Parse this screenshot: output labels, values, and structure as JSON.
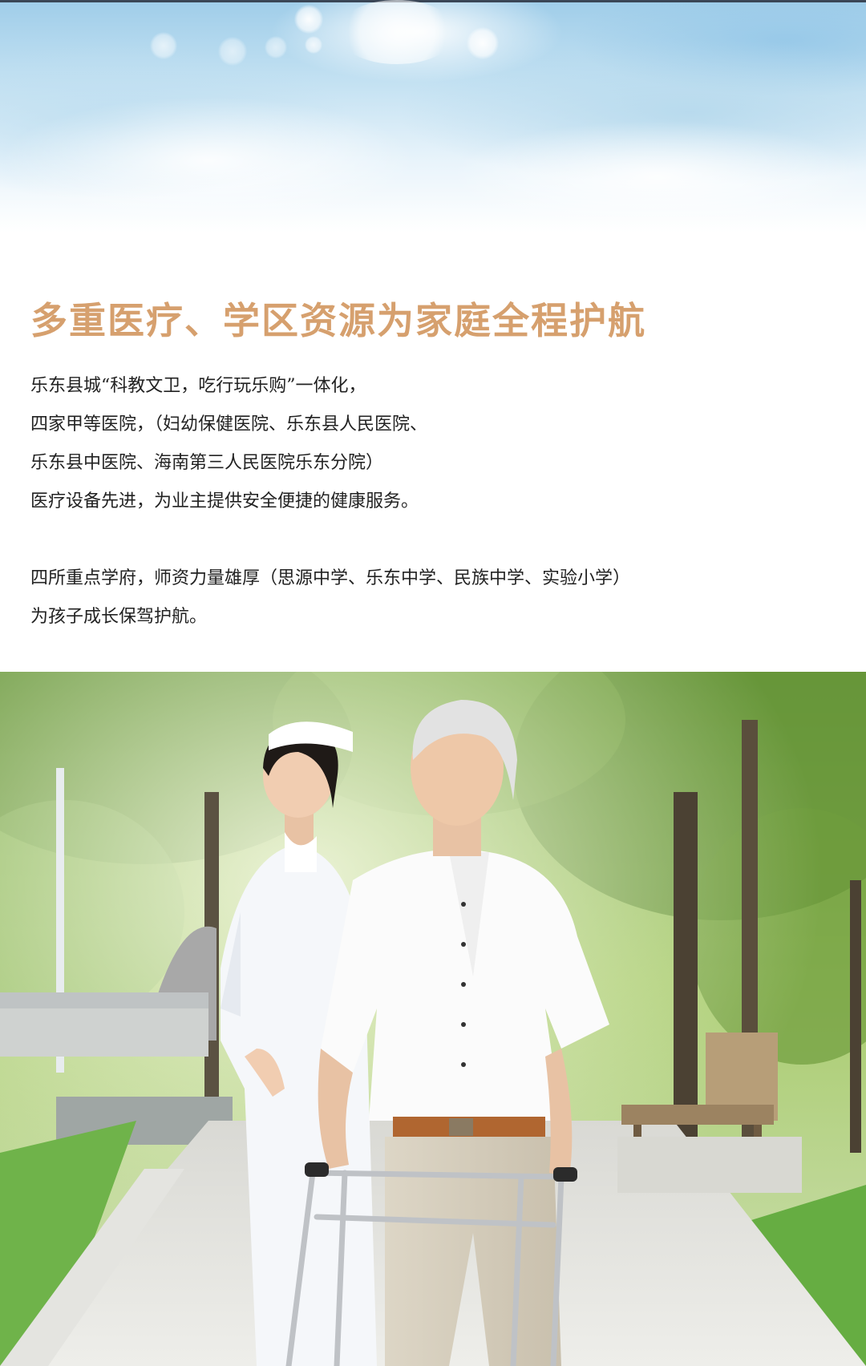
{
  "headline": "多重医疗、学区资源为家庭全程护航",
  "paragraph_1": [
    "乐东县城“科教文卫，吃行玩乐购”一体化，",
    "四家甲等医院，（妇幼保健医院、乐东县人民医院、",
    "乐东县中医院、海南第三人民医院乐东分院）",
    "医疗设备先进，为业主提供安全便捷的健康服务。"
  ],
  "paragraph_2": [
    "四所重点学府，师资力量雄厚（思源中学、乐东中学、民族中学、实验小学）",
    "为孩子成长保驾护航。"
  ],
  "colors": {
    "headline": "#d6a06e",
    "body_text": "#222222",
    "sky": "#9fcde9"
  },
  "images": {
    "top": "sky-banner",
    "bottom": "nurse-elderly-man-walker-park"
  }
}
